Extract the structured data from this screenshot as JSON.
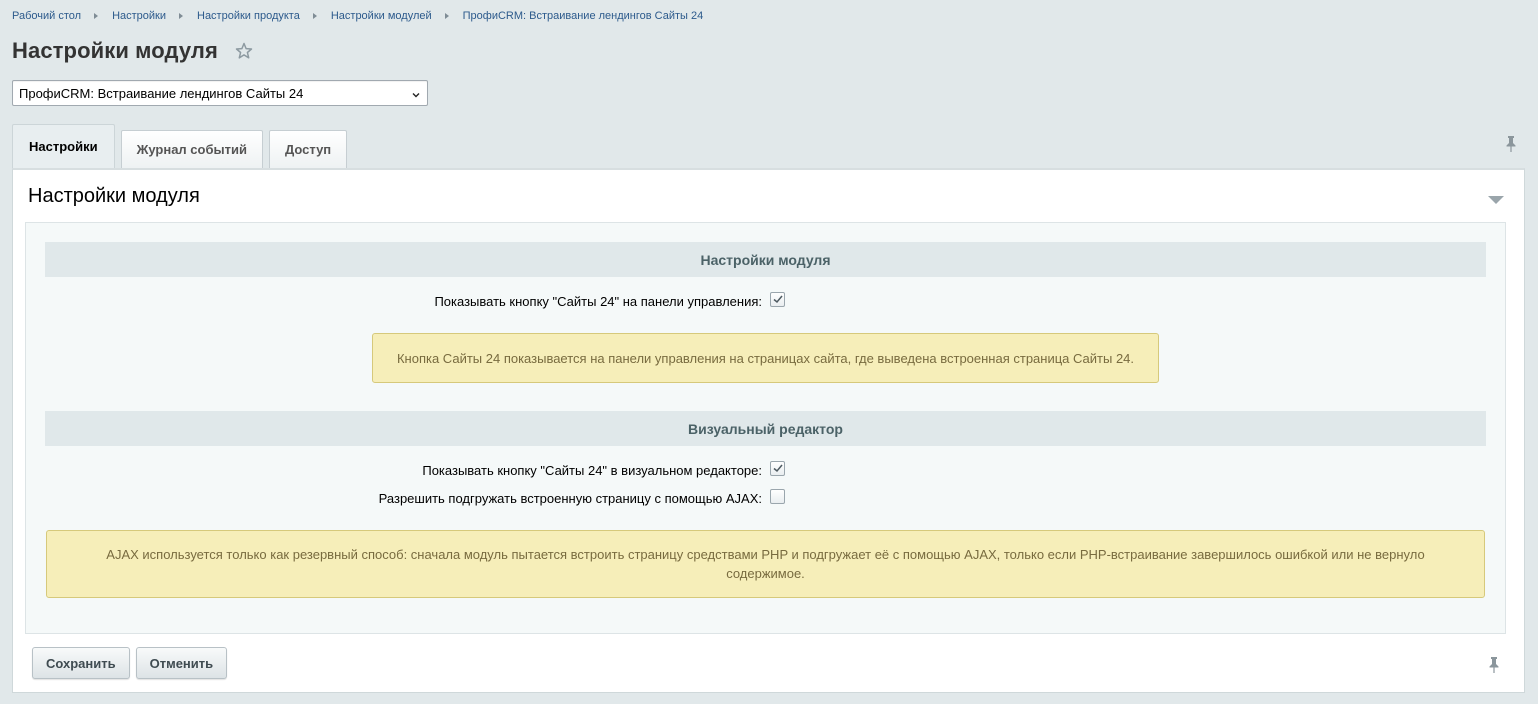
{
  "breadcrumbs": [
    "Рабочий стол",
    "Настройки",
    "Настройки продукта",
    "Настройки модулей",
    "ПрофиCRM: Встраивание лендингов Сайты 24"
  ],
  "page": {
    "title": "Настройки модуля"
  },
  "module_select": {
    "value": "ПрофиCRM: Встраивание лендингов Сайты 24"
  },
  "tabs": [
    {
      "label": "Настройки",
      "active": true
    },
    {
      "label": "Журнал событий",
      "active": false
    },
    {
      "label": "Доступ",
      "active": false
    }
  ],
  "panel": {
    "title": "Настройки модуля",
    "sections": [
      {
        "heading": "Настройки модуля",
        "fields": [
          {
            "label": "Показывать кнопку \"Сайты 24\" на панели управления:",
            "checked": true
          }
        ],
        "note": "Кнопка Сайты 24 показывается на панели управления на страницах сайта, где выведена встроенная страница Сайты 24."
      },
      {
        "heading": "Визуальный редактор",
        "fields": [
          {
            "label": "Показывать кнопку \"Сайты 24\" в визуальном редакторе:",
            "checked": true
          },
          {
            "label": "Разрешить подгружать встроенную страницу с помощью AJAX:",
            "checked": false
          }
        ],
        "note": "AJAX используется только как резервный способ: сначала модуль пытается встроить страницу средствами PHP и подгружает её с помощью AJAX, только если PHP-встраивание завершилось ошибкой или не вернуло содержимое."
      }
    ]
  },
  "buttons": {
    "save": "Сохранить",
    "cancel": "Отменить"
  },
  "colors": {
    "background": "#e1e8ea",
    "link": "#2c5a8c",
    "note_bg": "#f6eeb9",
    "note_text": "#786b3f",
    "section_head_bg": "#e0e8ea"
  },
  "icons": [
    "breadcrumb-arrow-icon",
    "star-icon",
    "chevron-down-icon",
    "pin-icon",
    "collapse-triangle-icon",
    "check-mark-icon"
  ]
}
